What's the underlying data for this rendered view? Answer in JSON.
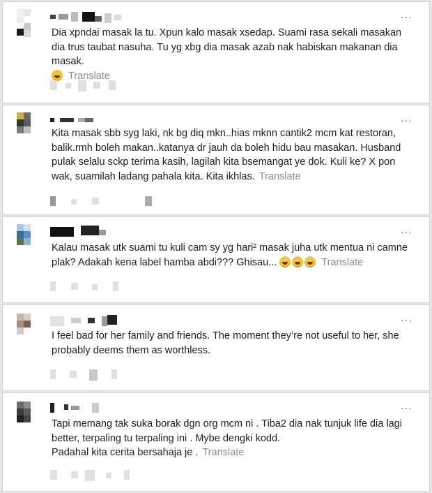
{
  "comments": [
    {
      "text": "Dia xpndai masak la tu. Xpun kalo masak xsedap. Suami rasa sekali masakan dia trus taubat nasuha. Tu yg xbg dia masak azab nak habiskan makanan dia masak.",
      "emoji_before_translate": [
        "face-with-tears-of-joy"
      ],
      "translate_label": "Translate",
      "more_label": "···"
    },
    {
      "text": "Kita masak sbb syg laki, nk bg diq mkn..hias mknn cantik2 mcm kat restoran, balik.rmh boleh makan..katanya dr jauh da boleh hidu bau masakan. Husband pulak selalu sckp terima kasih, lagilah kita bsemangat ye dok. Kuli ke? X pon wak, suamilah ladang pahala kita. Kita ikhlas.",
      "translate_label": "Translate",
      "more_label": "···"
    },
    {
      "text": "Kalau masak utk suami tu kuli cam sy yg hari² masak juha utk mentua ni camne plak? Adakah kena label hamba abdi??? Ghisau...",
      "emoji_after_text": [
        "grinning-face-with-sweat",
        "grinning-face-with-sweat",
        "grinning-face-with-sweat"
      ],
      "translate_label": "Translate",
      "more_label": "···"
    },
    {
      "text": "I feel bad for her family and friends. The moment they’re not useful to her, she probably deems them as worthless.",
      "more_label": "···"
    },
    {
      "text_lines": [
        "Tapi memang tak suka borak dgn org mcm ni . Tiba2 dia nak tunjuk life dia lagi better, terpaling tu terpaling ini . Mybe dengki kodd.",
        "Padahal kita cerita bersahaja je ."
      ],
      "translate_label": "Translate",
      "more_label": "···"
    }
  ]
}
